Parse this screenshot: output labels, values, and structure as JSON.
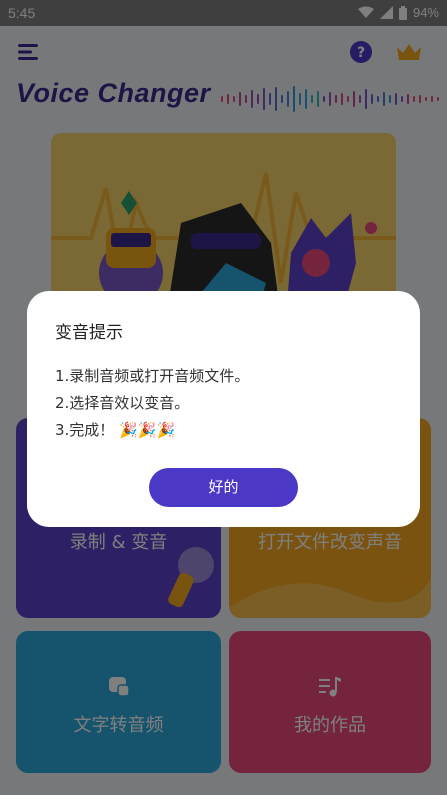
{
  "status_bar": {
    "time": "5:45",
    "battery": "94%"
  },
  "app": {
    "logo": "Voice Changer",
    "cards": {
      "record": "录制 & 变音",
      "open_file": "打开文件改变声音",
      "tts": "文字转音频",
      "works": "我的作品"
    }
  },
  "dialog": {
    "title": "变音提示",
    "line1": "1.录制音频或打开音频文件。",
    "line2": "2.选择音效以变音。",
    "line3": "3.完成！",
    "line3_emoji": "🎉🎉🎉",
    "ok_label": "好的"
  },
  "colors": {
    "accent": "#4b38c7",
    "record_card": "#5b40c9",
    "open_card": "#f5a623",
    "tts_card": "#2ba8d8",
    "works_card": "#e8487b"
  },
  "icons": [
    "menu-icon",
    "help-icon",
    "crown-icon",
    "wifi-icon",
    "signal-icon",
    "battery-icon",
    "microphone-icon",
    "translate-icon",
    "music-list-icon"
  ]
}
